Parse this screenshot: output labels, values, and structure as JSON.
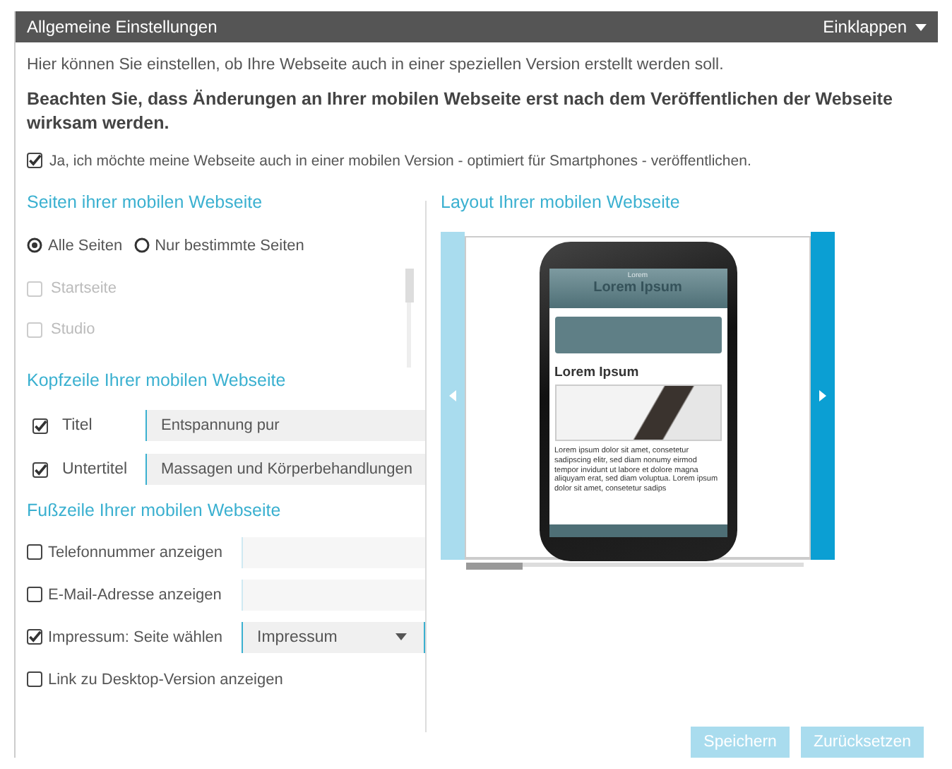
{
  "panel": {
    "title": "Allgemeine Einstellungen",
    "collapse_label": "Einklappen"
  },
  "intro": "Hier können Sie einstellen, ob Ihre Webseite auch in einer speziellen Version erstellt werden soll.",
  "notice": "Beachten Sie, dass Änderungen an Ihrer mobilen Webseite erst nach dem Veröffentlichen der Webseite wirksam werden.",
  "enable_mobile": {
    "label": "Ja, ich möchte meine Webseite auch in einer mobilen Version - optimiert für Smartphones - veröffentlichen.",
    "checked": true
  },
  "pages_section": {
    "heading": "Seiten ihrer mobilen Webseite",
    "scope": [
      {
        "label": "Alle Seiten",
        "selected": true
      },
      {
        "label": "Nur bestimmte Seiten",
        "selected": false
      }
    ],
    "pages": [
      {
        "label": "Startseite",
        "checked": false,
        "disabled": true
      },
      {
        "label": "Studio",
        "checked": false,
        "disabled": true
      }
    ]
  },
  "header_section": {
    "heading": "Kopfzeile Ihrer mobilen Webseite",
    "rows": [
      {
        "label": "Titel",
        "checked": true,
        "value": "Entspannung pur"
      },
      {
        "label": "Untertitel",
        "checked": true,
        "value": "Massagen und Körperbehandlungen"
      }
    ]
  },
  "footer_section": {
    "heading": "Fußzeile Ihrer mobilen Webseite",
    "rows": [
      {
        "kind": "text",
        "label": "Telefonnummer anzeigen",
        "checked": false
      },
      {
        "kind": "text",
        "label": "E-Mail-Adresse anzeigen",
        "checked": false
      },
      {
        "kind": "select",
        "label": "Impressum: Seite wählen",
        "checked": true,
        "value": "Impressum"
      },
      {
        "kind": "plain",
        "label": "Link zu Desktop-Version anzeigen",
        "checked": false
      }
    ]
  },
  "layout_section": {
    "heading": "Layout Ihrer mobilen Webseite",
    "prev_disabled": true,
    "next_disabled": false,
    "preview": {
      "top_label": "Lorem",
      "site_title": "Lorem Ipsum",
      "content_heading": "Lorem Ipsum",
      "content_text": "Lorem ipsum dolor sit amet, consetetur sadipscing elitr, sed diam nonumy eirmod tempor invidunt ut labore et dolore magna aliquyam erat, sed diam voluptua. Lorem ipsum dolor sit amet, consetetur sadips"
    }
  },
  "buttons": [
    {
      "label": "Speichern",
      "disabled": true
    },
    {
      "label": "Zurücksetzen",
      "disabled": true
    }
  ]
}
